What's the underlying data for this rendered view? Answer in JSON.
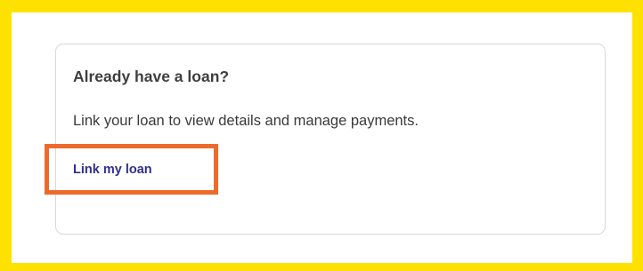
{
  "card": {
    "title": "Already have a loan?",
    "description": "Link your loan to view details and manage payments.",
    "link_label": "Link my loan"
  },
  "colors": {
    "frame_border": "#ffe100",
    "highlight_border": "#ee6a2b",
    "link_text": "#2e2f8f",
    "card_border": "#d8d8d8"
  }
}
